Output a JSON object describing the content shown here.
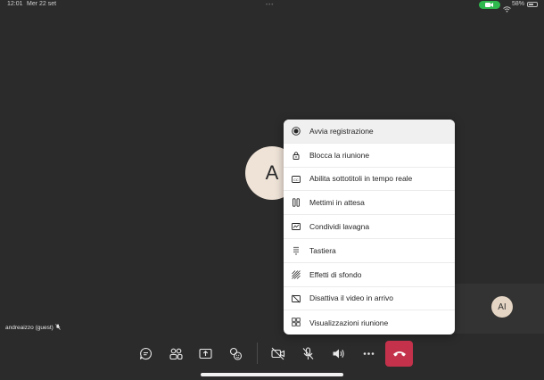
{
  "status_bar": {
    "time": "12:01",
    "date": "Mer 22 set",
    "battery": "58%"
  },
  "meeting": {
    "main_avatar_initial": "A",
    "small_avatar_initials": "AI",
    "guest_label": "andreaizzo (guest)"
  },
  "menu": {
    "items": [
      {
        "label": "Avvia registrazione",
        "icon": "record-icon"
      },
      {
        "label": "Blocca la riunione",
        "icon": "lock-icon"
      },
      {
        "label": "Abilita sottotitoli in tempo reale",
        "icon": "captions-icon"
      },
      {
        "label": "Mettimi in attesa",
        "icon": "pause-icon"
      },
      {
        "label": "Condividi lavagna",
        "icon": "whiteboard-icon"
      },
      {
        "label": "Tastiera",
        "icon": "keypad-icon"
      },
      {
        "label": "Effetti di sfondo",
        "icon": "background-effects-icon"
      },
      {
        "label": "Disattiva il video in arrivo",
        "icon": "video-off-icon"
      },
      {
        "label": "Visualizzazioni riunione",
        "icon": "view-layout-icon"
      }
    ]
  },
  "toolbar": {
    "buttons": [
      "chat-icon",
      "people-icon",
      "share-screen-icon",
      "reactions-icon",
      "camera-off-icon",
      "mic-off-icon",
      "speaker-icon",
      "more-icon",
      "hang-up-icon"
    ]
  },
  "colors": {
    "background": "#2b2b2b",
    "hangup": "#c4314b",
    "camera_indicator": "#2fb84e"
  }
}
